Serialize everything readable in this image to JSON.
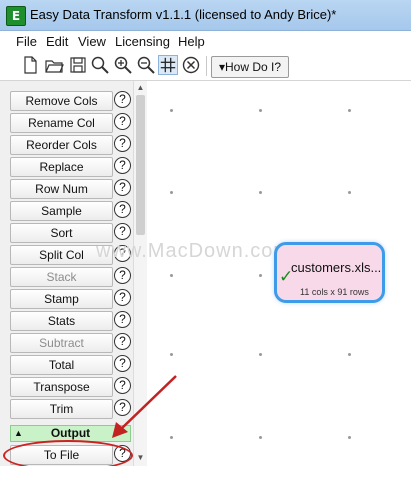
{
  "window": {
    "title": "Easy Data Transform v1.1.1 (licensed to Andy Brice)*",
    "icon_glyph": "E",
    "icon_color": "#1e8f2c"
  },
  "menu": [
    "File",
    "Edit",
    "View",
    "Licensing",
    "Help"
  ],
  "toolbar": {
    "icons": [
      "new-file-icon",
      "open-folder-icon",
      "save-icon",
      "search-icon",
      "zoom-in-icon",
      "zoom-out-icon",
      "grid-icon",
      "cancel-icon"
    ],
    "how_do_i_label": "▾How Do I?"
  },
  "transforms": [
    {
      "label": "Remove Cols",
      "enabled": true
    },
    {
      "label": "Rename Col",
      "enabled": true
    },
    {
      "label": "Reorder Cols",
      "enabled": true
    },
    {
      "label": "Replace",
      "enabled": true
    },
    {
      "label": "Row Num",
      "enabled": true
    },
    {
      "label": "Sample",
      "enabled": true
    },
    {
      "label": "Sort",
      "enabled": true
    },
    {
      "label": "Split Col",
      "enabled": true
    },
    {
      "label": "Stack",
      "enabled": false
    },
    {
      "label": "Stamp",
      "enabled": true
    },
    {
      "label": "Stats",
      "enabled": true
    },
    {
      "label": "Subtract",
      "enabled": false
    },
    {
      "label": "Total",
      "enabled": true
    },
    {
      "label": "Transpose",
      "enabled": true
    },
    {
      "label": "Trim",
      "enabled": true
    }
  ],
  "help_glyph": "?",
  "output_section": {
    "label": "Output",
    "toggle": "▲",
    "items": [
      {
        "label": "To File",
        "enabled": true
      }
    ]
  },
  "canvas": {
    "node": {
      "title": "customers.xls...",
      "status_glyph": "✓",
      "subtitle": "11 cols x 91 rows",
      "border_color": "#3d9be8",
      "fill_color": "#f8d9e9"
    },
    "watermark": "www.MacDown.com"
  },
  "annotation": {
    "color": "#c22222"
  }
}
